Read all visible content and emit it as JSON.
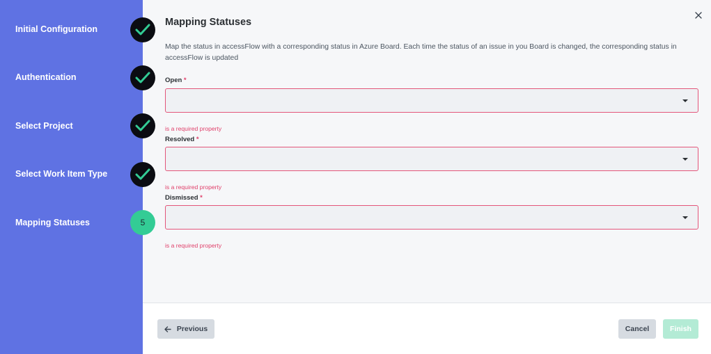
{
  "steps": [
    {
      "label": "Initial Configuration",
      "status": "done"
    },
    {
      "label": "Authentication",
      "status": "done"
    },
    {
      "label": "Select Project",
      "status": "done"
    },
    {
      "label": "Select Work Item Type",
      "status": "done"
    },
    {
      "label": "Mapping Statuses",
      "status": "current",
      "number": "5"
    }
  ],
  "main": {
    "title": "Mapping Statuses",
    "description": "Map the status in accessFlow with a corresponding status in Azure Board. Each time the status of an issue in you Board is changed, the corresponding status in accessFlow is updated"
  },
  "fields": [
    {
      "label": "Open",
      "required_mark": "*",
      "value": "",
      "error": "is a required property"
    },
    {
      "label": "Resolved",
      "required_mark": "*",
      "value": "",
      "error": "is a required property"
    },
    {
      "label": "Dismissed",
      "required_mark": "*",
      "value": "",
      "error": "is a required property"
    }
  ],
  "footer": {
    "previous_label": "Previous",
    "cancel_label": "Cancel",
    "finish_label": "Finish"
  },
  "colors": {
    "sidebar": "#5f72e3",
    "done_badge": "#0b0c12",
    "check": "#33cc95",
    "current_badge": "#33cc95",
    "error": "#e0416b",
    "finish_disabled": "#b3ebd5"
  }
}
